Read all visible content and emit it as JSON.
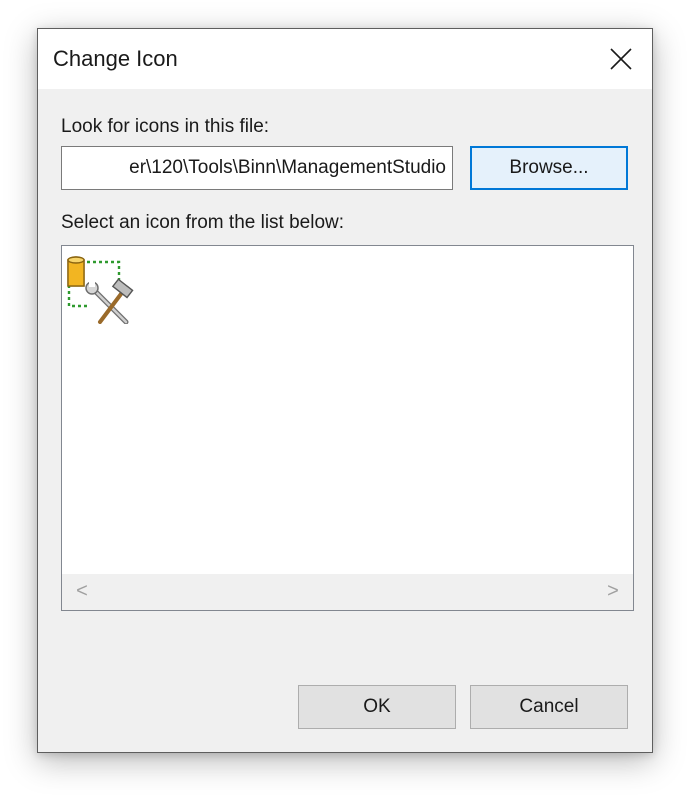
{
  "dialog": {
    "title": "Change Icon",
    "close_icon": "close-icon"
  },
  "file_section": {
    "label": "Look for icons in this file:",
    "path_value": "er\\120\\Tools\\Binn\\ManagementStudio",
    "browse_label": "Browse..."
  },
  "icon_section": {
    "label": "Select an icon from the list below:",
    "icons": [
      {
        "name": "database-tools-icon",
        "selected": true
      }
    ]
  },
  "scrollbar": {
    "left_arrow": "<",
    "right_arrow": ">"
  },
  "actions": {
    "ok_label": "OK",
    "cancel_label": "Cancel"
  },
  "colors": {
    "dialog_bg": "#f0f0f0",
    "titlebar_bg": "#ffffff",
    "default_button_border": "#0078d7",
    "button_bg": "#e1e1e1"
  }
}
